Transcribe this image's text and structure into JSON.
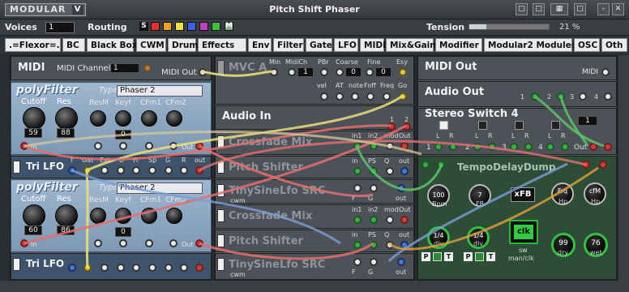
{
  "window": {
    "logo": "MODULAR",
    "logo_v": "V",
    "title": "Pitch Shift Phaser"
  },
  "voices": {
    "label": "Voices",
    "value": "1"
  },
  "routing": {
    "label": "Routing",
    "s_label": "S",
    "m_label": "M",
    "swatches": [
      "#e03030",
      "#f0a020",
      "#f0e040",
      "#4060e0",
      "#c040c0",
      "#40c040"
    ]
  },
  "tension": {
    "label": "Tension",
    "value_text": "21 %",
    "fraction": 0.21
  },
  "tabs": [
    ".=Flexor=.",
    "BC",
    "Black Box II",
    "CWM",
    "Drum",
    "Effects",
    "Env",
    "Filter",
    "Gate",
    "LFO",
    "MIDI",
    "Mix&Gain",
    "Modifier",
    "Modular2 Modules",
    "OSC",
    "Oth"
  ],
  "col1": {
    "midi": {
      "title": "MIDI",
      "channel_label": "MIDI Channel",
      "channel_value": "1",
      "midi_out": "MIDI Out"
    },
    "pf1": {
      "name": "polyFilter",
      "type_label": "Type",
      "type_value": "Phaser 2",
      "cutoff": "Cutoff",
      "res": "Res",
      "resm": "ResM",
      "keyf": "Keyf",
      "cfm1": "CFm1",
      "cfm2": "CFm2",
      "cutoff_val": "59",
      "res_val": "88",
      "keyf_val": "0",
      "in": "In",
      "out": "Out"
    },
    "lfo1": {
      "title": "Tri LFO",
      "ports": [
        "f",
        "Gat",
        "Ext",
        "D",
        "Fi",
        "Sp",
        "G",
        "R",
        "out"
      ]
    },
    "pf2": {
      "name": "polyFilter",
      "type_label": "Type",
      "type_value": "Phaser 2",
      "cutoff": "Cutoff",
      "res": "Res",
      "resm": "ResM",
      "keyf": "Keyf",
      "cfm1": "CFm1",
      "cfm2": "CFm2",
      "cutoff_val": "60",
      "res_val": "86",
      "keyf_val": "0",
      "in": "In",
      "out": "Out"
    },
    "lfo2": {
      "title": "Tri LFO"
    }
  },
  "col2": {
    "mvca": {
      "title": "MVC A",
      "labels": [
        "Min",
        "MidiCh",
        "PBr",
        "Coarse",
        "Fine",
        "Esy"
      ],
      "values": [
        "1",
        "0",
        "0"
      ],
      "labels2": [
        "vel",
        "AT",
        "note",
        "Foff",
        "Freq",
        "Go"
      ]
    },
    "audio_in": {
      "title": "Audio In",
      "ports": [
        "1",
        "2"
      ]
    },
    "crossfade1": {
      "title": "Crossfade Mix",
      "ports": [
        "in1",
        "in2",
        "mod",
        "Out"
      ]
    },
    "pitch1": {
      "title": "Pitch Shifter",
      "ports": [
        "in",
        "PS",
        "Q",
        "out"
      ]
    },
    "tiny1": {
      "title": "TinySineLfo SRC",
      "sub": "cwm",
      "ports": [
        "F",
        "G",
        "out"
      ]
    },
    "crossfade2": {
      "title": "Crossfade Mix",
      "ports": [
        "in1",
        "in2",
        "mod",
        "Out"
      ]
    },
    "pitch2": {
      "title": "Pitch Shifter",
      "ports": [
        "in",
        "PS",
        "Q",
        "out"
      ]
    },
    "tiny2": {
      "title": "TinySineLfo SRC",
      "sub": "cwm",
      "ports": [
        "F",
        "G",
        "out"
      ]
    }
  },
  "col3": {
    "midi_out": {
      "title": "MIDI Out",
      "midi": "MIDI"
    },
    "audio_out": {
      "title": "Audio Out",
      "ports": [
        "1",
        "2",
        "3",
        "4"
      ]
    },
    "stereo": {
      "title": "Stereo Switch 4",
      "value": "1",
      "l": "L",
      "r": "R",
      "nums": [
        "1",
        "2",
        "3",
        "4"
      ],
      "out": "Out"
    },
    "tempo": {
      "title": "TempoDelayDump",
      "bpm_val": "100",
      "bpm": "Bpm",
      "fb_val": "7",
      "fb": "FB",
      "xfb": "xFB",
      "frq": "Frq",
      "hp": "Hp",
      "cfm": "cfM",
      "div1_val": "1/4",
      "div2_val": "1/4",
      "div": "div",
      "clk": "clk",
      "sw": "sw",
      "manclk": "man/clk",
      "dry_val": "99",
      "dry": "dry",
      "wet_val": "76",
      "wet": "wet",
      "p": "P",
      "t": "T"
    }
  }
}
